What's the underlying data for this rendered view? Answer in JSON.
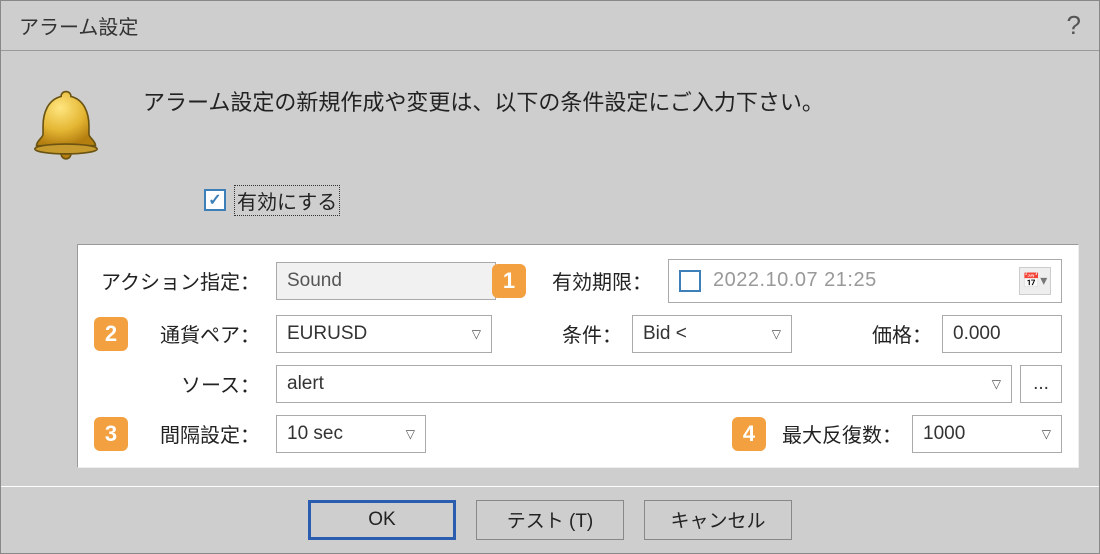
{
  "title": "アラーム設定",
  "intro": "アラーム設定の新規作成や変更は、以下の条件設定にご入力下さい。",
  "enable_label": "有効にする",
  "labels": {
    "action": "アクション指定：",
    "expiration": "有効期限：",
    "pair": "通貨ペア：",
    "condition": "条件：",
    "price": "価格：",
    "source": "ソース：",
    "interval": "間隔設定：",
    "max_repeat": "最大反復数："
  },
  "values": {
    "action": "Sound",
    "expiration": "2022.10.07 21:25",
    "pair": "EURUSD",
    "condition": "Bid <",
    "price": "0.000",
    "source": "alert",
    "interval": "10 sec",
    "max_repeat": "1000"
  },
  "buttons": {
    "ok": "OK",
    "test": "テスト (T)",
    "cancel": "キャンセル",
    "browse": "..."
  },
  "badges": {
    "b1": "1",
    "b2": "2",
    "b3": "3",
    "b4": "4"
  },
  "help": "?"
}
